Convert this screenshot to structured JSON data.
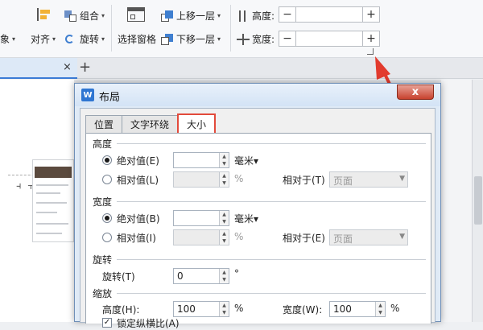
{
  "ribbon": {
    "partial_left": "象",
    "align_label": "对齐",
    "group_label": "组合",
    "rotate_label": "旋转",
    "selection_pane_label": "选择窗格",
    "bring_forward_label": "上移一层",
    "send_backward_label": "下移一层",
    "height_label": "高度:",
    "width_label": "宽度:",
    "minus": "−",
    "plus": "+"
  },
  "tabbar": {
    "close": "×",
    "add": "+"
  },
  "dialog": {
    "title": "布局",
    "close": "x",
    "tabs": [
      {
        "label": "位置",
        "active": false
      },
      {
        "label": "文字环绕",
        "active": false
      },
      {
        "label": "大小",
        "active": true
      }
    ],
    "height_section": {
      "title": "高度",
      "absolute_label": "绝对值(E)",
      "absolute_value": "",
      "absolute_unit": "毫米▾",
      "relative_label": "相对值(L)",
      "relative_value": "",
      "relative_unit": "%",
      "relative_to_label": "相对于(T)",
      "relative_to_value": "页面"
    },
    "width_section": {
      "title": "宽度",
      "absolute_label": "绝对值(B)",
      "absolute_value": "",
      "absolute_unit": "毫米▾",
      "relative_label": "相对值(I)",
      "relative_value": "",
      "relative_unit": "%",
      "relative_to_label": "相对于(E)",
      "relative_to_value": "页面"
    },
    "rotate_section": {
      "title": "旋转",
      "rotate_label": "旋转(T)",
      "rotate_value": "0",
      "rotate_unit": "°"
    },
    "scale_section": {
      "title": "缩放",
      "height_label": "高度(H):",
      "height_value": "100",
      "height_unit": "%",
      "width_label": "宽度(W):",
      "width_value": "100",
      "width_unit": "%",
      "lock_label": "锁定纵横比(A)",
      "lock_checked": true
    }
  },
  "colors": {
    "highlight": "#e24a3b",
    "accent": "#2f76d2"
  }
}
